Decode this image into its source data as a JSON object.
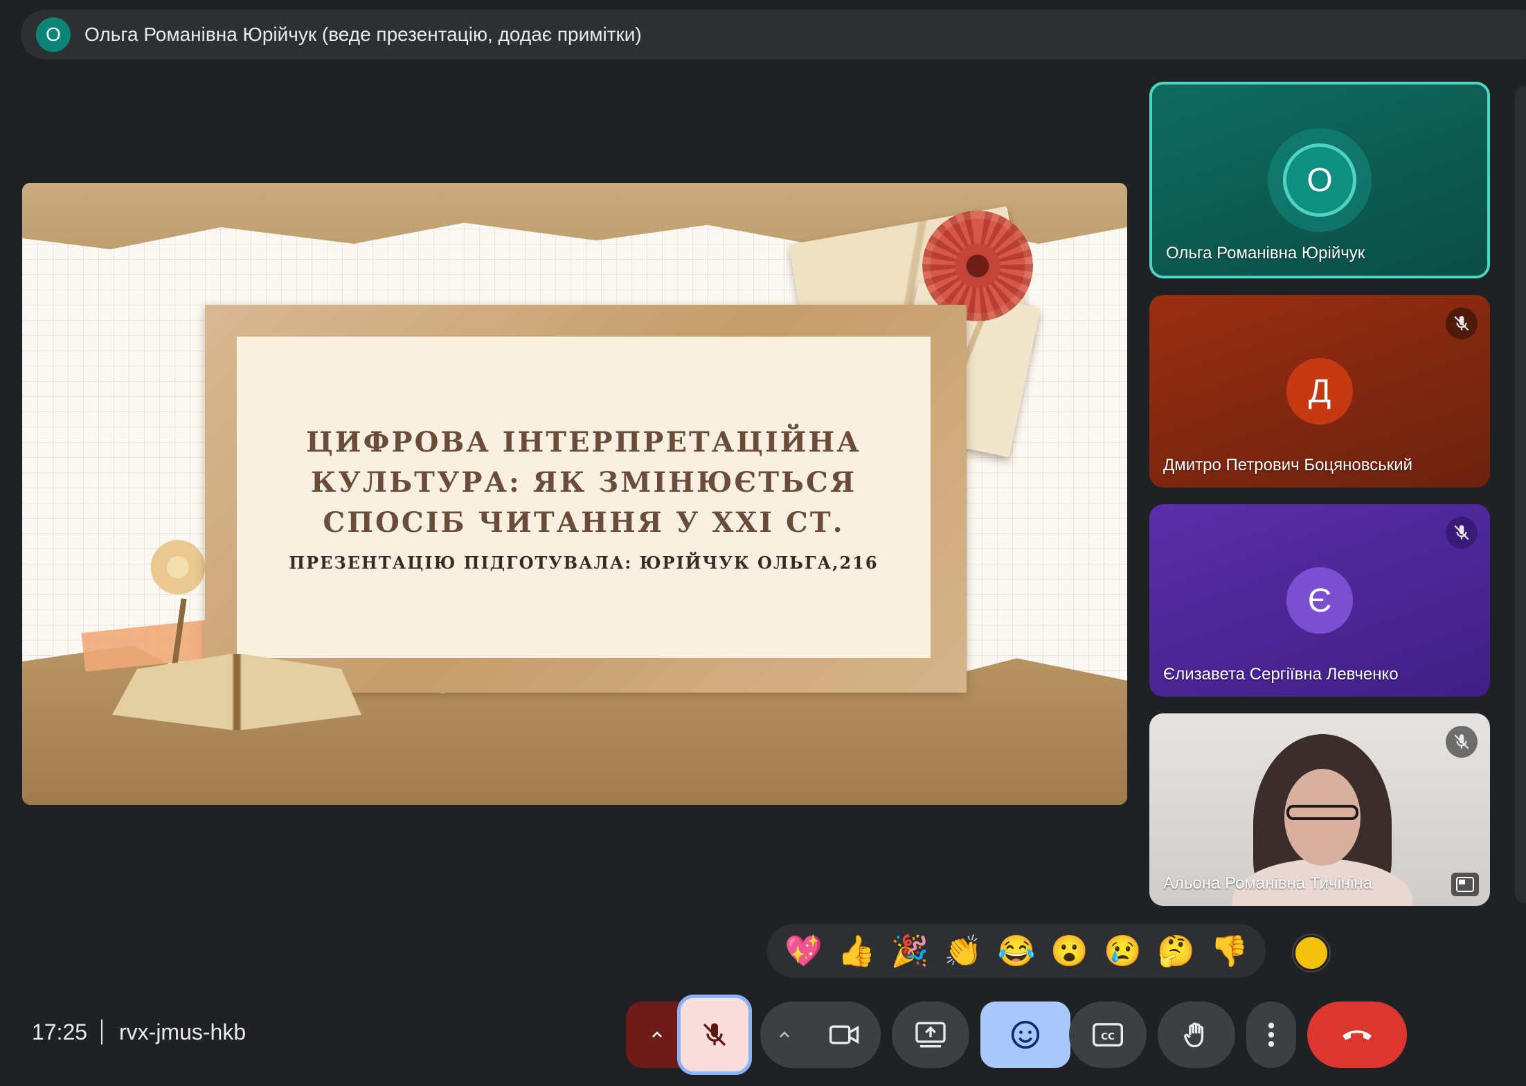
{
  "banner": {
    "avatar_letter": "О",
    "text": "Ольга Романівна Юрійчук (веде презентацію, додає примітки)"
  },
  "slide": {
    "title": "ЦИФРОВА ІНТЕРПРЕТАЦІЙНА КУЛЬТУРА: ЯК ЗМІНЮЄТЬСЯ СПОСІБ ЧИТАННЯ У ХХІ СТ.",
    "subtitle": "ПРЕЗЕНТАЦІЮ ПІДГОТУВАЛА: ЮРІЙЧУК ОЛЬГА,216"
  },
  "participants": [
    {
      "name": "Ольга Романівна Юрійчук",
      "initial": "О",
      "color": "#0e8f80",
      "speaking": true,
      "muted": false
    },
    {
      "name": "Дмитро Петрович Боцяновський",
      "initial": "Д",
      "color": "#c63a13",
      "muted": true
    },
    {
      "name": "Єлизавета Сергіївна Левченко",
      "initial": "Є",
      "color": "#7c4ed2",
      "muted": true
    },
    {
      "name": "Альона Романівна Тичініна",
      "initial": "",
      "video": true,
      "muted": true
    }
  ],
  "reactions": [
    "💖",
    "👍",
    "🎉",
    "👏",
    "😂",
    "😮",
    "😢",
    "🤔",
    "👎"
  ],
  "bottom_bar": {
    "time": "17:25",
    "meeting_code": "rvx-jmus-hkb"
  },
  "controls": {
    "mic": "mic-off-icon",
    "camera": "camera-icon",
    "present": "present-screen-icon",
    "emoji": "emoji-icon",
    "captions": "cc-icon",
    "raise_hand": "hand-icon",
    "more": "more-vert-icon",
    "leave": "call-end-icon",
    "leave_color": "#dc362e",
    "emoji_active_color": "#a8c7fa"
  }
}
